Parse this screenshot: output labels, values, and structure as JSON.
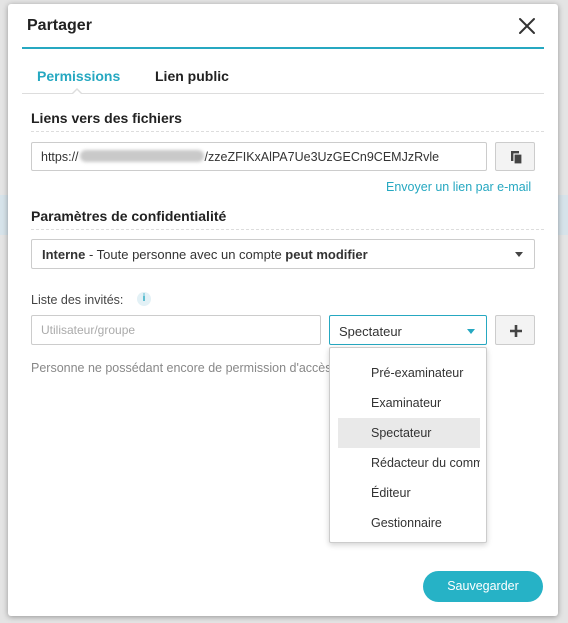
{
  "dialog": {
    "title": "Partager",
    "close_icon": "close-icon"
  },
  "tabs": [
    {
      "label": "Permissions",
      "active": true
    },
    {
      "label": "Lien public",
      "active": false
    }
  ],
  "file_links": {
    "section_title": "Liens vers des fichiers",
    "url_prefix": "https://",
    "url_suffix": "/zzeZFIKxAlPA7Ue3UzGECn9CEMJzRvle",
    "copy_icon": "copy-icon",
    "email_link": "Envoyer un lien par e-mail"
  },
  "privacy": {
    "section_title": "Paramètres de confidentialité",
    "selected_bold": "Interne",
    "selected_middle": " - Toute personne avec un compte ",
    "selected_bold2": "peut modifier"
  },
  "invitees": {
    "label": "Liste des invités:",
    "info_icon": "info-icon",
    "user_placeholder": "Utilisateur/groupe",
    "role_selected": "Spectateur",
    "add_icon": "plus-icon",
    "empty_text": "Personne ne possédant encore de permission d'accès"
  },
  "role_options": [
    "Pré-examinateur",
    "Examinateur",
    "Spectateur",
    "Rédacteur du commentaire",
    "Éditeur",
    "Gestionnaire"
  ],
  "footer": {
    "save_label": "Sauvegarder"
  },
  "colors": {
    "accent": "#26a8c1",
    "save_button": "#26b2c6"
  }
}
